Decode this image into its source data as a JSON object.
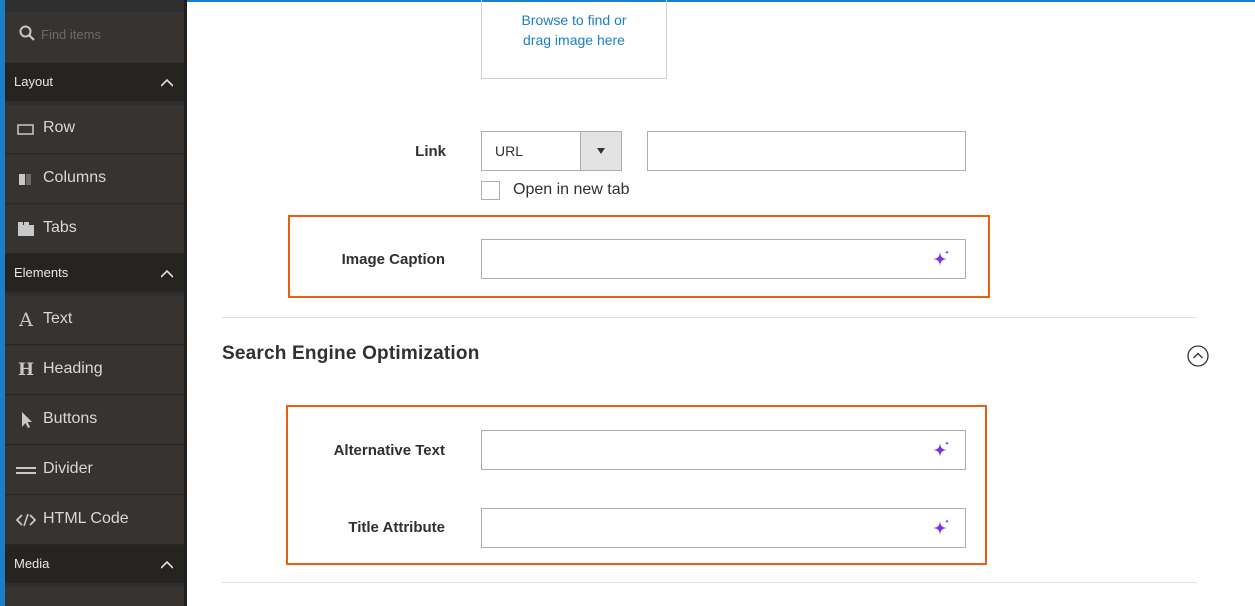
{
  "sidebar": {
    "search_placeholder": "Find items",
    "sections": [
      {
        "label": "Layout"
      },
      {
        "label": "Elements"
      },
      {
        "label": "Media"
      }
    ],
    "items": [
      {
        "label": "Row",
        "icon": "row-icon"
      },
      {
        "label": "Columns",
        "icon": "columns-icon"
      },
      {
        "label": "Tabs",
        "icon": "tabs-icon"
      },
      {
        "label": "Text",
        "icon": "text-icon"
      },
      {
        "label": "Heading",
        "icon": "heading-icon"
      },
      {
        "label": "Buttons",
        "icon": "buttons-icon"
      },
      {
        "label": "Divider",
        "icon": "divider-icon"
      },
      {
        "label": "HTML Code",
        "icon": "html-code-icon"
      }
    ]
  },
  "upload": {
    "text_line1": "Browse to find or",
    "text_line2": "drag image here"
  },
  "link": {
    "label": "Link",
    "type_value": "URL",
    "url_value": "",
    "open_new_tab_label": "Open in new tab"
  },
  "caption": {
    "label": "Image Caption",
    "value": ""
  },
  "seo": {
    "title": "Search Engine Optimization",
    "alt_label": "Alternative Text",
    "alt_value": "",
    "title_attr_label": "Title Attribute",
    "title_attr_value": ""
  },
  "colors": {
    "accent_blue": "#1a7fc7",
    "highlight_orange": "#eb5f0c",
    "sparkle_purple": "#7b2ff0",
    "sidebar_bg": "#373330"
  }
}
